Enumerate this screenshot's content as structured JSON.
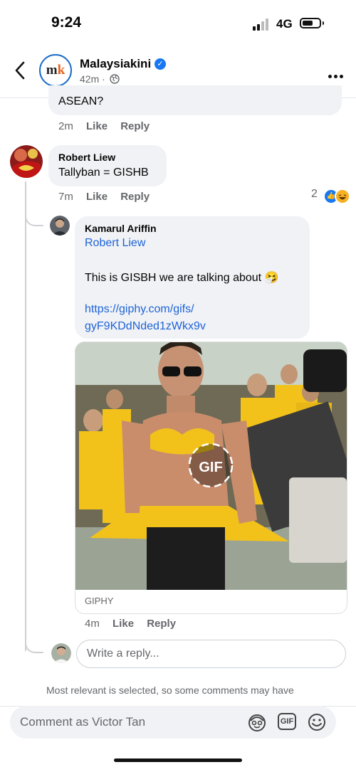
{
  "status_bar": {
    "time": "9:24",
    "network": "4G"
  },
  "header": {
    "page_name": "Malaysiakini",
    "logo_m": "m",
    "logo_k": "k",
    "time_ago": "42m ·"
  },
  "comments": {
    "previous": {
      "text": "ASEAN?",
      "time": "2m",
      "like": "Like",
      "reply": "Reply"
    },
    "robert": {
      "name": "Robert Liew",
      "text": "Tallyban = GISHB",
      "time": "7m",
      "like": "Like",
      "reply": "Reply",
      "reaction_count": "2"
    },
    "kamarul": {
      "name": "Kamarul Ariffin",
      "mention": "Robert Liew",
      "text": "This is GISBH we are talking about 🤧",
      "link_line1": "https://giphy.com/gifs/",
      "link_line2": "gyF9KDdNded1zWkx9v",
      "gif_badge": "GIF",
      "gif_source": "GIPHY",
      "time": "4m",
      "like": "Like",
      "reply": "Reply"
    }
  },
  "reply_input": {
    "placeholder": "Write a reply..."
  },
  "notice": "Most relevant is selected, so some comments may have",
  "comment_bar": {
    "placeholder": "Comment as Victor Tan",
    "gif_label": "GIF"
  },
  "colors": {
    "link": "#1e63d8",
    "brand_blue": "#1877f2",
    "bubble": "#f0f2f5",
    "gif_shirt": "#f2c21b"
  }
}
